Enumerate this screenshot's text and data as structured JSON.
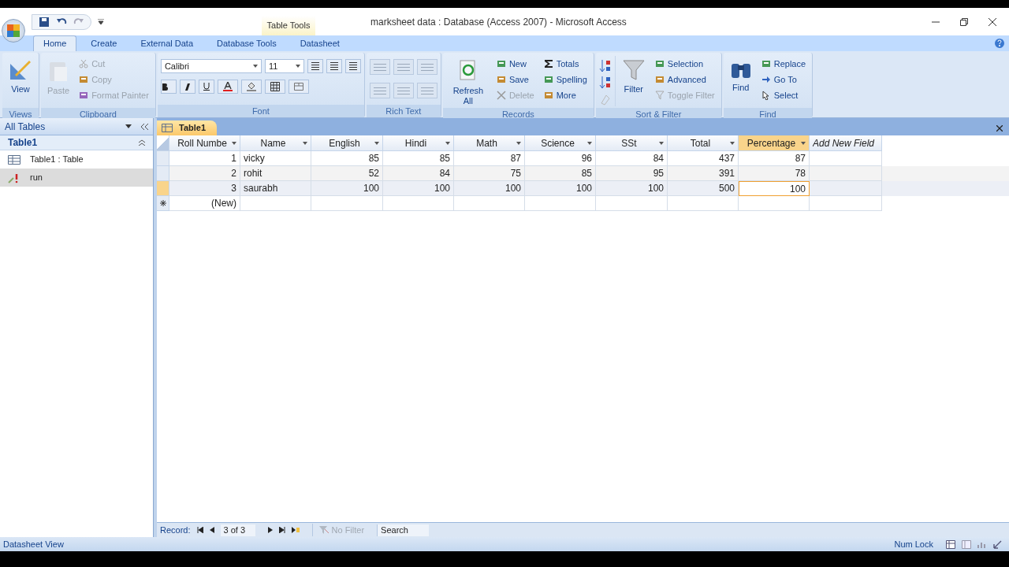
{
  "window": {
    "title": "marksheet data : Database (Access 2007) - Microsoft Access",
    "context_tab": "Table Tools"
  },
  "ribbon_tabs": [
    {
      "label": "Home",
      "selected": true
    },
    {
      "label": "Create",
      "selected": false
    },
    {
      "label": "External Data",
      "selected": false
    },
    {
      "label": "Database Tools",
      "selected": false
    },
    {
      "label": "Datasheet",
      "selected": false
    }
  ],
  "ribbon_groups": [
    {
      "name": "Views",
      "kind": "views",
      "items": [
        {
          "label": "View",
          "kind": "large",
          "disabled": false
        }
      ]
    },
    {
      "name": "Clipboard",
      "kind": "clipboard",
      "items": [
        {
          "label": "Paste",
          "kind": "large",
          "disabled": true
        },
        {
          "label": "Cut",
          "kind": "small",
          "disabled": true
        },
        {
          "label": "Copy",
          "kind": "small",
          "disabled": true
        },
        {
          "label": "Format Painter",
          "kind": "small",
          "disabled": true
        }
      ]
    },
    {
      "name": "Font",
      "kind": "font",
      "font_name": "Calibri",
      "font_size": "11"
    },
    {
      "name": "Rich Text",
      "kind": "richtext"
    },
    {
      "name": "Records",
      "kind": "records",
      "items": [
        {
          "label": "Refresh All",
          "kind": "large",
          "disabled": false
        },
        {
          "label": "New",
          "kind": "small",
          "disabled": false
        },
        {
          "label": "Save",
          "kind": "small",
          "disabled": false
        },
        {
          "label": "Delete",
          "kind": "small",
          "disabled": true
        },
        {
          "label": "Totals",
          "kind": "small",
          "disabled": false
        },
        {
          "label": "Spelling",
          "kind": "small",
          "disabled": false
        },
        {
          "label": "More",
          "kind": "small",
          "disabled": false
        }
      ]
    },
    {
      "name": "Sort & Filter",
      "kind": "sort",
      "items": [
        {
          "label": "Filter",
          "kind": "large",
          "disabled": false
        },
        {
          "label": "Selection",
          "kind": "small",
          "disabled": false
        },
        {
          "label": "Advanced",
          "kind": "small",
          "disabled": false
        },
        {
          "label": "Toggle Filter",
          "kind": "small",
          "disabled": true
        }
      ]
    },
    {
      "name": "Find",
      "kind": "find",
      "items": [
        {
          "label": "Find",
          "kind": "large",
          "disabled": false
        },
        {
          "label": "Replace",
          "kind": "small",
          "disabled": false
        },
        {
          "label": "Go To",
          "kind": "small",
          "disabled": false
        },
        {
          "label": "Select",
          "kind": "small",
          "disabled": false
        }
      ]
    }
  ],
  "nav_pane": {
    "header": "All Tables",
    "group": "Table1",
    "items": [
      {
        "label": "Table1 : Table",
        "kind": "table",
        "selected": false
      },
      {
        "label": "run",
        "kind": "query",
        "selected": true
      }
    ]
  },
  "document_tab": "Table1",
  "table": {
    "columns": [
      {
        "label": "Roll Numbe",
        "kind": "number",
        "selected": false
      },
      {
        "label": "Name",
        "kind": "text",
        "selected": false
      },
      {
        "label": "English",
        "kind": "number",
        "selected": false
      },
      {
        "label": "Hindi",
        "kind": "number",
        "selected": false
      },
      {
        "label": "Math",
        "kind": "number",
        "selected": false
      },
      {
        "label": "Science",
        "kind": "number",
        "selected": false
      },
      {
        "label": "SSt",
        "kind": "number",
        "selected": false
      },
      {
        "label": "Total",
        "kind": "number",
        "selected": false
      },
      {
        "label": "Percentage",
        "kind": "number",
        "selected": true
      },
      {
        "label": "Add New Field",
        "kind": "add",
        "selected": false
      }
    ],
    "rows": [
      {
        "cells": [
          "1",
          "vicky",
          "85",
          "85",
          "87",
          "96",
          "84",
          "437",
          "87"
        ],
        "selected": false
      },
      {
        "cells": [
          "2",
          "rohit",
          "52",
          "84",
          "75",
          "85",
          "95",
          "391",
          "78"
        ],
        "selected": false
      },
      {
        "cells": [
          "3",
          "saurabh",
          "100",
          "100",
          "100",
          "100",
          "100",
          "500",
          "100"
        ],
        "selected": true
      }
    ],
    "new_row": "(New)"
  },
  "record_nav": {
    "label": "Record:",
    "position": "3 of 3",
    "filter": "No Filter",
    "search": "Search"
  },
  "status_bar": {
    "left": "Datasheet View",
    "right": "Num Lock"
  }
}
